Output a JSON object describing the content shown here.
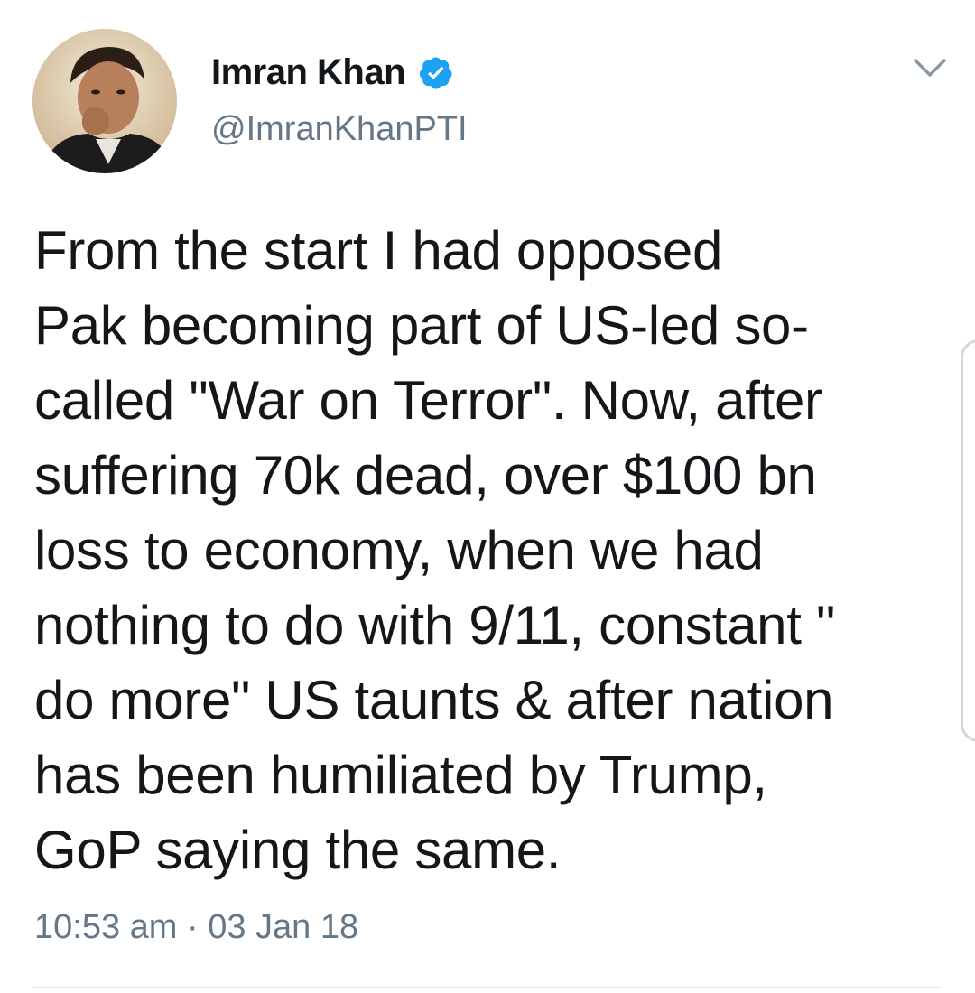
{
  "tweet": {
    "author": {
      "display_name": "Imran Khan",
      "handle": "@ImranKhanPTI",
      "verified": true,
      "avatar_icon": "profile-photo"
    },
    "text": "From the start I had opposed\nPak becoming part of US-led so-\ncalled \"War on Terror\". Now, after\nsuffering 70k dead, over $100 bn\nloss to economy, when we had\nnothing to do with 9/11, constant \"\ndo more\" US taunts & after nation\nhas been humiliated by Trump,\nGoP saying the same.",
    "timestamp": "10:53 am · 03 Jan 18",
    "menu_icon": "chevron-down-icon"
  },
  "colors": {
    "text": "#14171a",
    "secondary": "#657786",
    "verified": "#1da1f2",
    "divider": "#e1e8ed"
  }
}
